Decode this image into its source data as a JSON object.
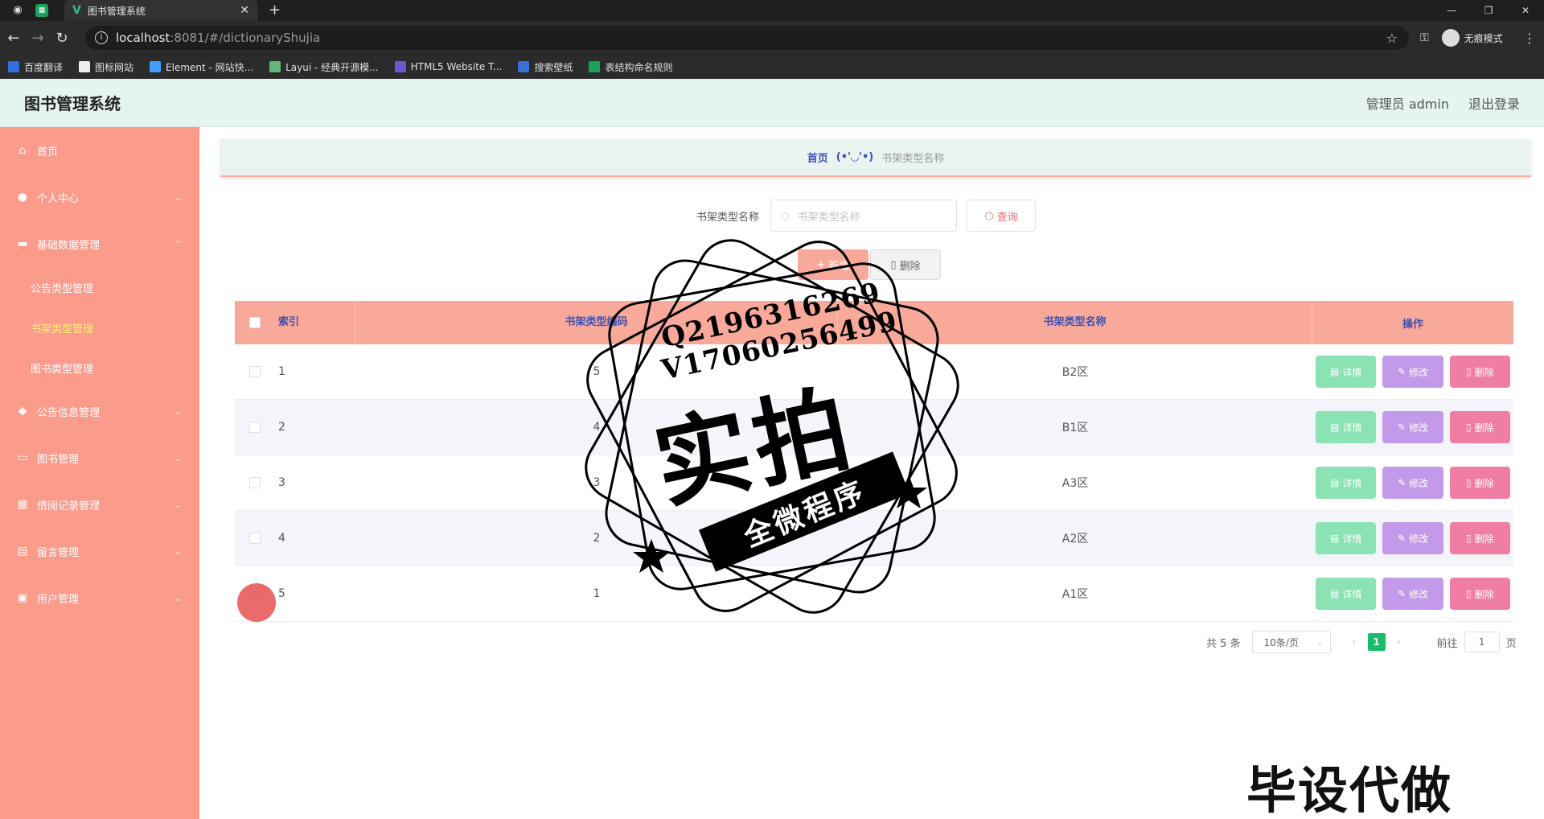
{
  "browser": {
    "tab_title": "图书管理系统",
    "url_host": "localhost",
    "url_path": ":8081/#/dictionaryShujia",
    "incognito_label": "无痕模式",
    "bookmarks": [
      {
        "label": "百度翻译",
        "color": "#2f6de1"
      },
      {
        "label": "图标网站",
        "color": "#333333"
      },
      {
        "label": "Element - 网站快...",
        "color": "#409eff"
      },
      {
        "label": "Layui - 经典开源模...",
        "color": "#5fb878"
      },
      {
        "label": "HTML5 Website T...",
        "color": "#6a5acd"
      },
      {
        "label": "搜索壁纸",
        "color": "#3a6fd8"
      },
      {
        "label": "表结构命名规则",
        "color": "#19a35b"
      }
    ]
  },
  "header": {
    "title": "图书管理系统",
    "user": "管理员 admin",
    "logout": "退出登录"
  },
  "sidebar": {
    "items": [
      {
        "label": "首页"
      },
      {
        "label": "个人中心"
      },
      {
        "label": "基础数据管理"
      },
      {
        "label": "公告类型管理"
      },
      {
        "label": "书架类型管理"
      },
      {
        "label": "图书类型管理"
      },
      {
        "label": "公告信息管理"
      },
      {
        "label": "图书管理"
      },
      {
        "label": "借阅记录管理"
      },
      {
        "label": "留言管理"
      },
      {
        "label": "用户管理"
      }
    ]
  },
  "breadcrumb": {
    "home": "首页",
    "separator": "(•'◡'•)",
    "current": "书架类型名称"
  },
  "search": {
    "label": "书架类型名称",
    "placeholder": "书架类型名称",
    "button": "查询"
  },
  "actions": {
    "add": "新增",
    "delete": "删除"
  },
  "table": {
    "headers": {
      "index": "索引",
      "code": "书架类型编码",
      "name": "书架类型名称",
      "ops": "操作"
    },
    "rows": [
      {
        "index": "1",
        "code": "5",
        "name": "B2区"
      },
      {
        "index": "2",
        "code": "4",
        "name": "B1区"
      },
      {
        "index": "3",
        "code": "3",
        "name": "A3区"
      },
      {
        "index": "4",
        "code": "2",
        "name": "A2区"
      },
      {
        "index": "5",
        "code": "1",
        "name": "A1区"
      }
    ],
    "op_labels": {
      "detail": "详情",
      "edit": "修改",
      "delete": "删除"
    }
  },
  "pagination": {
    "total": "共 5 条",
    "page_size": "10条/页",
    "current_page": "1",
    "goto_label": "前往",
    "goto_value": "1",
    "page_suffix": "页"
  },
  "watermark": {
    "line1": "Q2196316269",
    "line2": "V17060256499",
    "big": "实拍",
    "ribbon": "全微程序",
    "bottom": "毕设代做"
  }
}
